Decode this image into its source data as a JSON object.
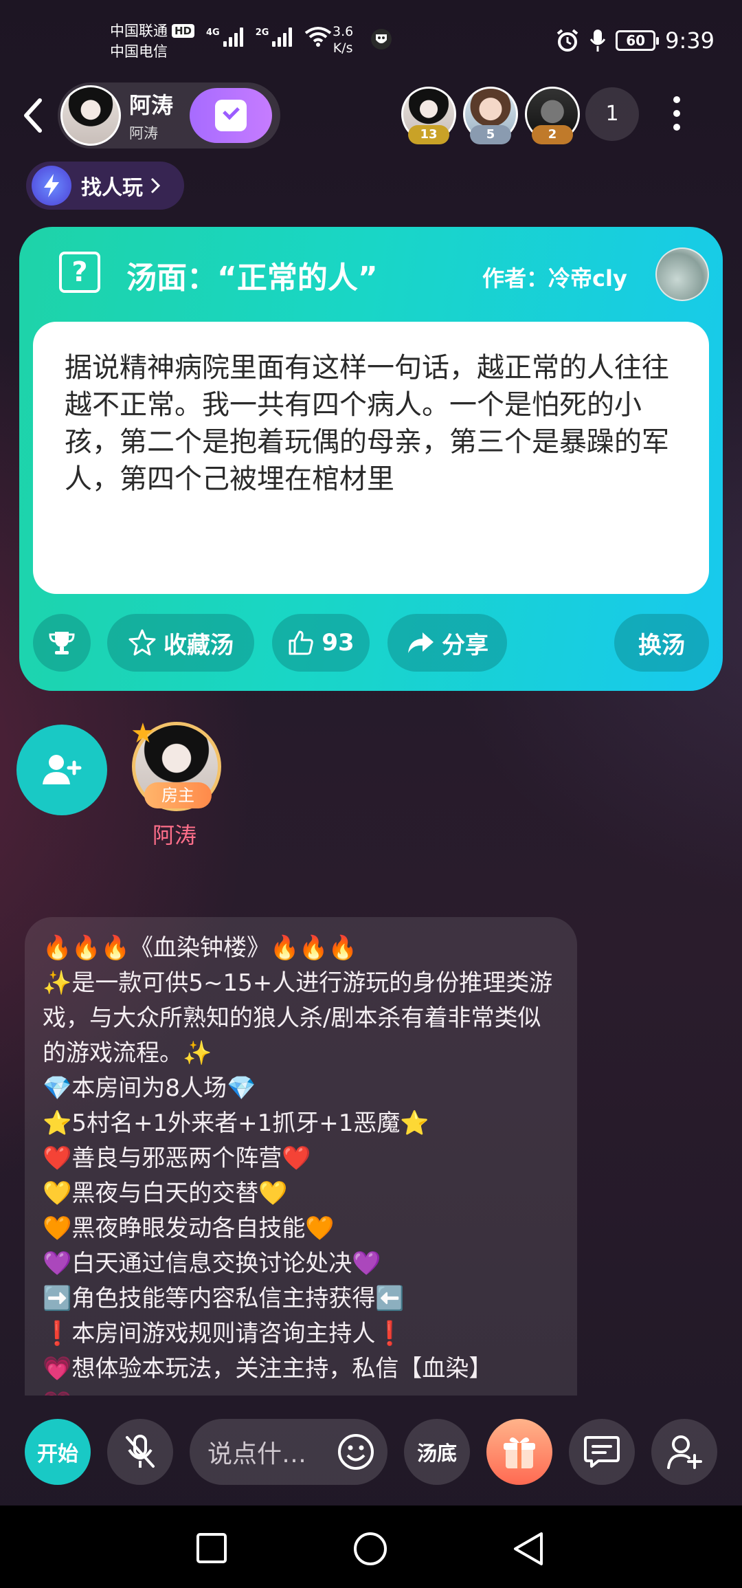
{
  "status_bar": {
    "carrier1": "中国联通",
    "carrier1_badge": "HD",
    "carrier2": "中国电信",
    "net1": "4G",
    "net2": "2G",
    "speed_value": "3.6",
    "speed_unit": "K/s",
    "battery": "60",
    "time": "9:39"
  },
  "header": {
    "host_name": "阿涛",
    "host_sub": "阿涛",
    "audience": [
      {
        "level": "13",
        "badge_color": "#c9a227"
      },
      {
        "level": "5",
        "badge_color": "#8a9bb0"
      },
      {
        "level": "2",
        "badge_color": "#c07a2a"
      }
    ],
    "audience_count": "1"
  },
  "find_play": {
    "label": "找人玩"
  },
  "soup_card": {
    "title": "汤面：“正常的人”",
    "author": "作者：冷帝cly",
    "body": "据说精神病院里面有这样一句话，越正常的人往往越不正常。我一共有四个病人。一个是怕死的小孩，第二个是抱着玩偶的母亲，第三个是暴躁的军人，第四个己被埋在棺材里",
    "actions": {
      "collect": "收藏汤",
      "likes": "93",
      "share": "分享",
      "change": "换汤"
    }
  },
  "seat": {
    "host_tag": "房主",
    "host_name": "阿涛"
  },
  "intro_lines": [
    "🔥🔥🔥《血染钟楼》🔥🔥🔥",
    "✨是一款可供5~15+人进行游玩的身份推理类游戏，与大众所熟知的狼人杀/剧本杀有着非常类似的游戏流程。✨",
    "💎本房间为8人场💎",
    "⭐5村名+1外来者+1抓牙+1恶魔⭐",
    "❤️善良与邪恶两个阵营❤️",
    "💛黑夜与白天的交替💛",
    "🧡黑夜睁眼发动各自技能🧡",
    "💜白天通过信息交换讨论处决💜",
    "➡️角色技能等内容私信主持获得⬅️",
    "❗本房间游戏规则请咨询主持人❗",
    "💗想体验本玩法，关注主持，私信【血染】",
    "💗"
  ],
  "bottom_bar": {
    "start": "开始",
    "chat_placeholder": "说点什…",
    "soup_end": "汤底"
  },
  "colors": {
    "accent_teal": "#19c9c5",
    "card_gradient_start": "#1ed3a8",
    "card_gradient_end": "#18c9ee",
    "follow_purple": "#a76bff",
    "seat_name_pink": "#ff6f8a"
  }
}
